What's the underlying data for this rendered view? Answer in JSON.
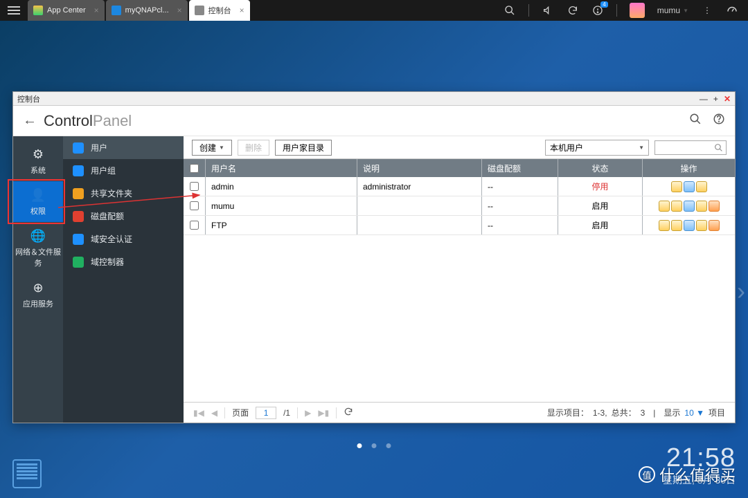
{
  "topbar": {
    "tabs": [
      {
        "label": "App Center",
        "active": false,
        "iconColor1": "#f7c24a",
        "iconColor2": "#3ad16e"
      },
      {
        "label": "myQNAPcl...",
        "active": false,
        "iconColor1": "#1c87e0",
        "iconColor2": "#1c87e0"
      },
      {
        "label": "控制台",
        "active": true,
        "iconColor1": "#888",
        "iconColor2": "#888"
      }
    ],
    "user": "mumu",
    "notification_badge": "4"
  },
  "window": {
    "title": "控制台",
    "headerBold": "Control",
    "headerThin": "Panel",
    "nav1": [
      {
        "label": "系统",
        "icon": "⚙"
      },
      {
        "label": "权限",
        "icon": "👤"
      },
      {
        "label": "网络＆文件服务",
        "icon": "🌐"
      },
      {
        "label": "应用服务",
        "icon": "⊕"
      }
    ],
    "nav2": [
      {
        "label": "用户",
        "color": "#1e90ff"
      },
      {
        "label": "用户组",
        "color": "#1e90ff"
      },
      {
        "label": "共享文件夹",
        "color": "#f0a020"
      },
      {
        "label": "磁盘配额",
        "color": "#e04030"
      },
      {
        "label": "域安全认证",
        "color": "#1e90ff"
      },
      {
        "label": "域控制器",
        "color": "#20b060"
      }
    ],
    "toolbar": {
      "create": "创建",
      "delete": "删除",
      "homeDir": "用户家目录",
      "userTypeSelected": "本机用户"
    },
    "table": {
      "headers": {
        "user": "用户名",
        "desc": "说明",
        "quota": "磁盘配额",
        "status": "状态",
        "action": "操作"
      },
      "rows": [
        {
          "user": "admin",
          "desc": "administrator",
          "quota": "--",
          "status": "停用",
          "stopped": true,
          "actions": 3
        },
        {
          "user": "mumu",
          "desc": "",
          "quota": "--",
          "status": "启用",
          "stopped": false,
          "actions": 5
        },
        {
          "user": "FTP",
          "desc": "",
          "quota": "--",
          "status": "启用",
          "stopped": false,
          "actions": 5
        }
      ]
    },
    "pager": {
      "pageLabel": "页面",
      "page": "1",
      "totalPages": "/1",
      "summaryPrefix": "显示项目：",
      "summaryRange": "1-3,",
      "summaryTotalLabel": "总共：",
      "summaryTotal": "3",
      "sep": "|",
      "showLabel": "显示",
      "pageSize": "10",
      "itemsLabel": "项目"
    }
  },
  "clock": {
    "time": "21:58",
    "date": "星期五, 8月 30日"
  },
  "watermark": "什么值得买"
}
